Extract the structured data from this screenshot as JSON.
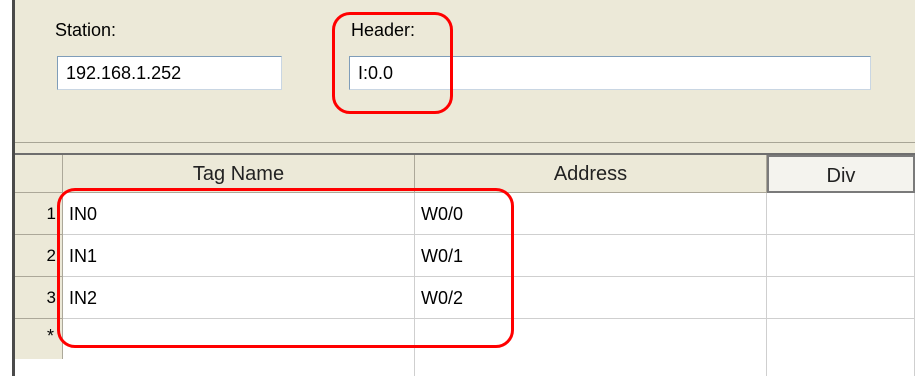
{
  "station": {
    "label": "Station:",
    "value": "192.168.1.252"
  },
  "header": {
    "label": "Header:",
    "value": "I:0.0"
  },
  "grid": {
    "columns": [
      "Tag Name",
      "Address",
      "Div"
    ],
    "rows": [
      {
        "num": "1",
        "tag": "IN0",
        "address": "W0/0",
        "div": ""
      },
      {
        "num": "2",
        "tag": "IN1",
        "address": "W0/1",
        "div": ""
      },
      {
        "num": "3",
        "tag": "IN2",
        "address": "W0/2",
        "div": ""
      }
    ],
    "new_row_marker": "*"
  },
  "colors": {
    "highlight": "#ff0000",
    "panel": "#ece9d8"
  }
}
